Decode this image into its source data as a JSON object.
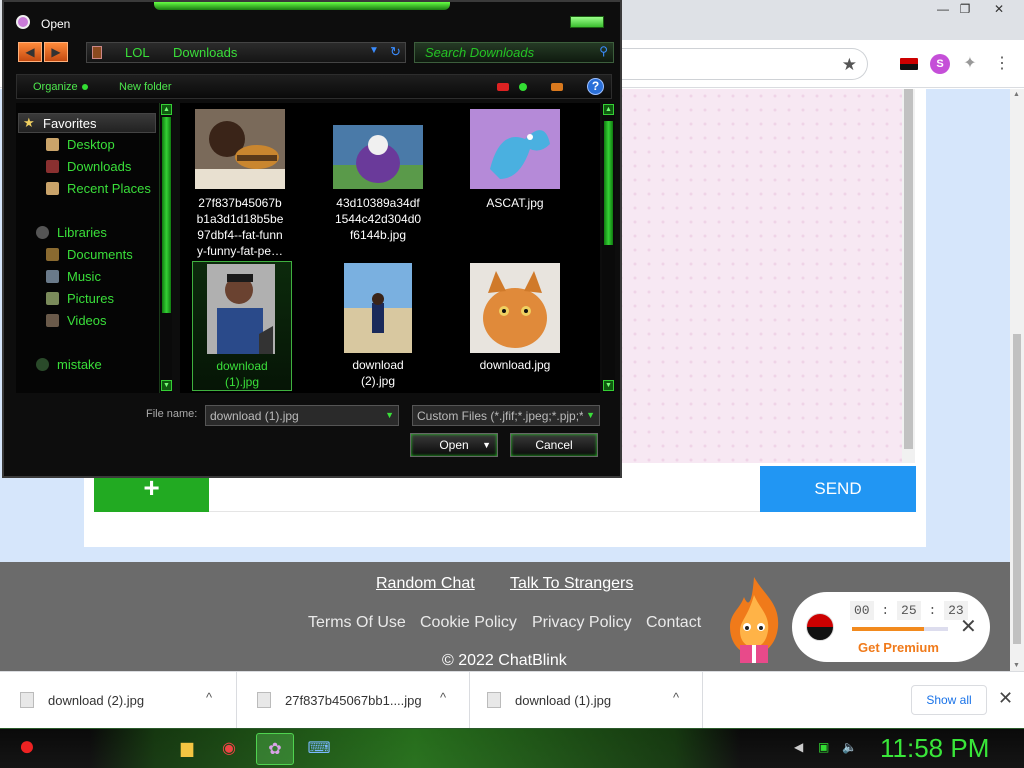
{
  "browser": {
    "window_controls": [
      "—",
      "❐",
      "✕"
    ],
    "star_icon": "★",
    "extensions": [
      "flag-angola-icon",
      "s-extension-icon",
      "puzzle-icon",
      "menu-icon"
    ],
    "s_ext_label": "S"
  },
  "chat": {
    "plus_label": "+",
    "send_label": "SEND"
  },
  "footer": {
    "random_chat": "Random Chat",
    "talk_to_strangers": "Talk To Strangers",
    "terms": "Terms Of Use",
    "cookie": "Cookie Policy",
    "privacy": "Privacy Policy",
    "contact": "Contact",
    "copyright": "© 2022 ChatBlink"
  },
  "premium": {
    "minutes": "00",
    "sep1": ":",
    "seconds": "25",
    "sep2": ":",
    "hundredths": "23",
    "progress_percent": 75,
    "label": "Get Premium",
    "close": "✕"
  },
  "downloads": {
    "items": [
      {
        "name": "download (2).jpg"
      },
      {
        "name": "27f837b45067bb1....jpg"
      },
      {
        "name": "download (1).jpg"
      }
    ],
    "chevron": "^",
    "show_all": "Show all",
    "close": "✕"
  },
  "taskbar": {
    "clock": "11:58 PM"
  },
  "dialog": {
    "title": "Open",
    "path": [
      "LOL",
      "Downloads"
    ],
    "search_placeholder": "Search Downloads",
    "organize": "Organize",
    "new_folder": "New folder",
    "help": "?",
    "nav": {
      "favorites": "Favorites",
      "desktop": "Desktop",
      "downloads": "Downloads",
      "recent": "Recent Places",
      "libraries": "Libraries",
      "documents": "Documents",
      "music": "Music",
      "pictures": "Pictures",
      "videos": "Videos",
      "mistake": "mistake"
    },
    "files": [
      {
        "label_lines": [
          "27f837b45067b",
          "b1a3d1d18b5be",
          "97dbf4--fat-funn",
          "y-funny-fat-pe…"
        ]
      },
      {
        "label_lines": [
          "43d10389a34df",
          "1544c42d304d0",
          "f6144b.jpg"
        ]
      },
      {
        "label_lines": [
          "ASCAT.jpg"
        ]
      },
      {
        "label_lines": [
          "download",
          "(1).jpg"
        ]
      },
      {
        "label_lines": [
          "download",
          "(2).jpg"
        ]
      },
      {
        "label_lines": [
          "download.jpg"
        ]
      }
    ],
    "file_name_label": "File name:",
    "file_name_value": "download (1).jpg",
    "file_type_value": "Custom Files (*.jfif;*.jpeg;*.pjp;*",
    "open_label": "Open",
    "cancel_label": "Cancel"
  }
}
